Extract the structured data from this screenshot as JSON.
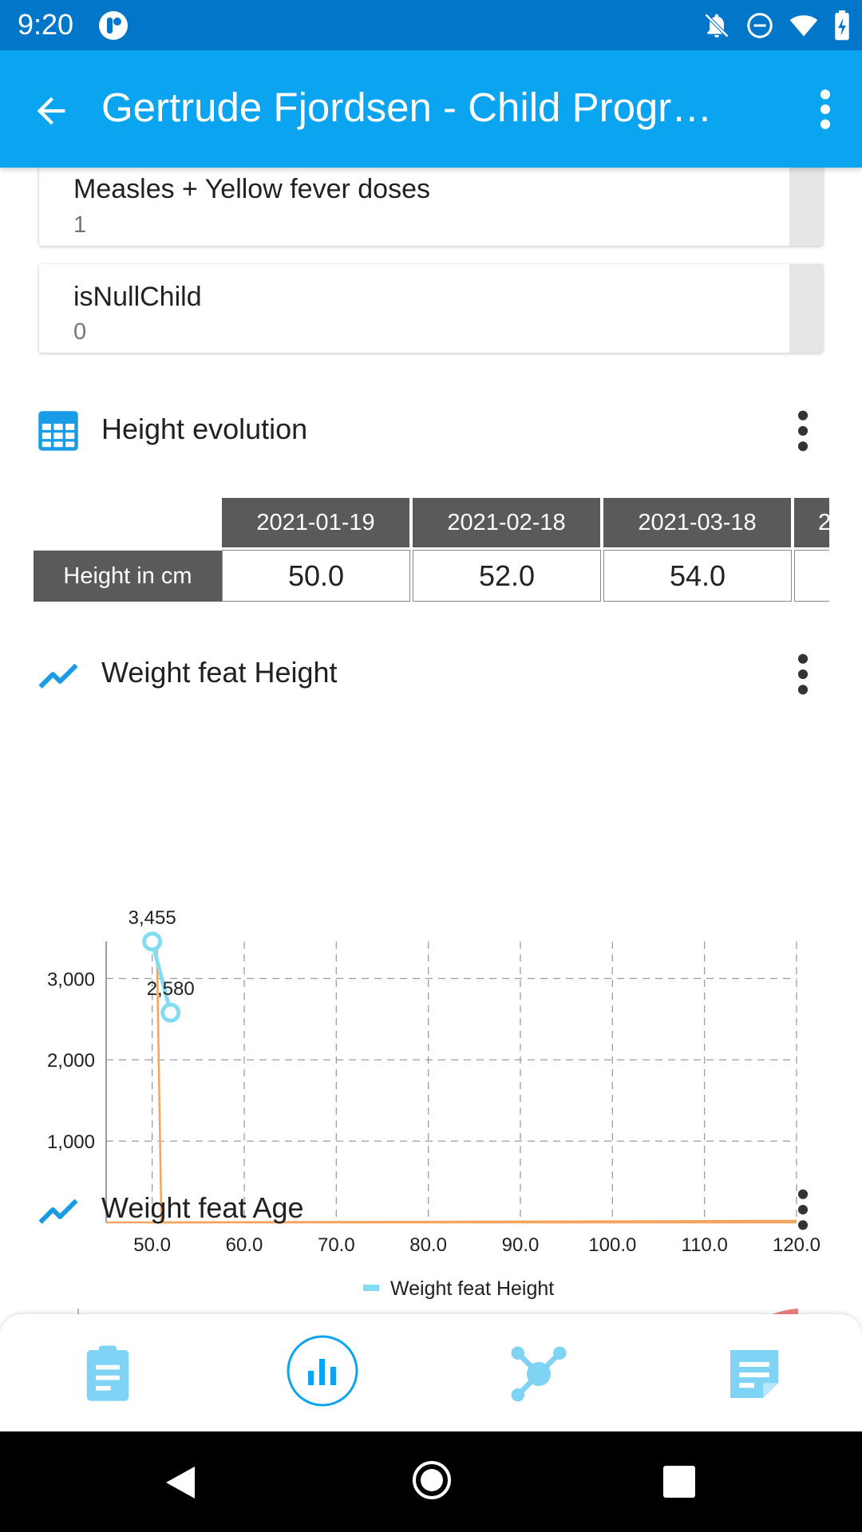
{
  "status_bar": {
    "time": "9:20",
    "icons": [
      "app-logo-icon",
      "notifications-off-icon",
      "do-not-disturb-icon",
      "wifi-icon",
      "battery-charging-icon"
    ]
  },
  "app_bar": {
    "title": "Gertrude Fjordsen - Child Progr…",
    "back_icon": "arrow-back-icon",
    "menu_icon": "more-vert-icon"
  },
  "indicators": [
    {
      "label": "Measles + Yellow fever doses",
      "value": "1"
    },
    {
      "label": "isNullChild",
      "value": "0"
    }
  ],
  "height_section": {
    "title": "Height evolution",
    "icon": "table-icon",
    "table": {
      "columns": [
        "2021-01-19",
        "2021-02-18",
        "2021-03-18",
        "2"
      ],
      "row_label": "Height in cm",
      "values": [
        "50.0",
        "52.0",
        "54.0",
        ""
      ]
    }
  },
  "weight_height_section": {
    "title": "Weight feat Height",
    "icon": "line-chart-icon"
  },
  "weight_age_section": {
    "title": "Weight feat Age",
    "icon": "line-chart-icon"
  },
  "chart_data": {
    "type": "line",
    "title": "",
    "xlabel": "",
    "ylabel": "",
    "xlim": [
      45,
      120
    ],
    "ylim": [
      0,
      3455
    ],
    "x_ticks": [
      "50.0",
      "60.0",
      "70.0",
      "80.0",
      "90.0",
      "100.0",
      "110.0",
      "120.0"
    ],
    "y_ticks": [
      "1,000",
      "2,000",
      "3,000"
    ],
    "grid": true,
    "legend": "bottom-center",
    "series": [
      {
        "name": "Weight feat Height",
        "color": "#84dcf2",
        "x": [
          50.0,
          52.0
        ],
        "y": [
          3455,
          2580
        ],
        "labels": [
          "3,455",
          "2,580"
        ]
      }
    ],
    "reference_lines": [
      {
        "color": "#f4a460",
        "x": [
          50.5,
          51.0,
          120.0
        ],
        "y": [
          3455,
          0,
          20
        ]
      }
    ]
  },
  "bottom_nav": {
    "items": [
      {
        "icon": "clipboard-icon",
        "active": false
      },
      {
        "icon": "bar-chart-icon",
        "active": true
      },
      {
        "icon": "network-icon",
        "active": false
      },
      {
        "icon": "notes-icon",
        "active": false
      }
    ],
    "accent": "#0aa4f0",
    "inactive": "#7fd3f5"
  },
  "system_nav": [
    "back-icon",
    "home-icon",
    "recents-icon"
  ]
}
